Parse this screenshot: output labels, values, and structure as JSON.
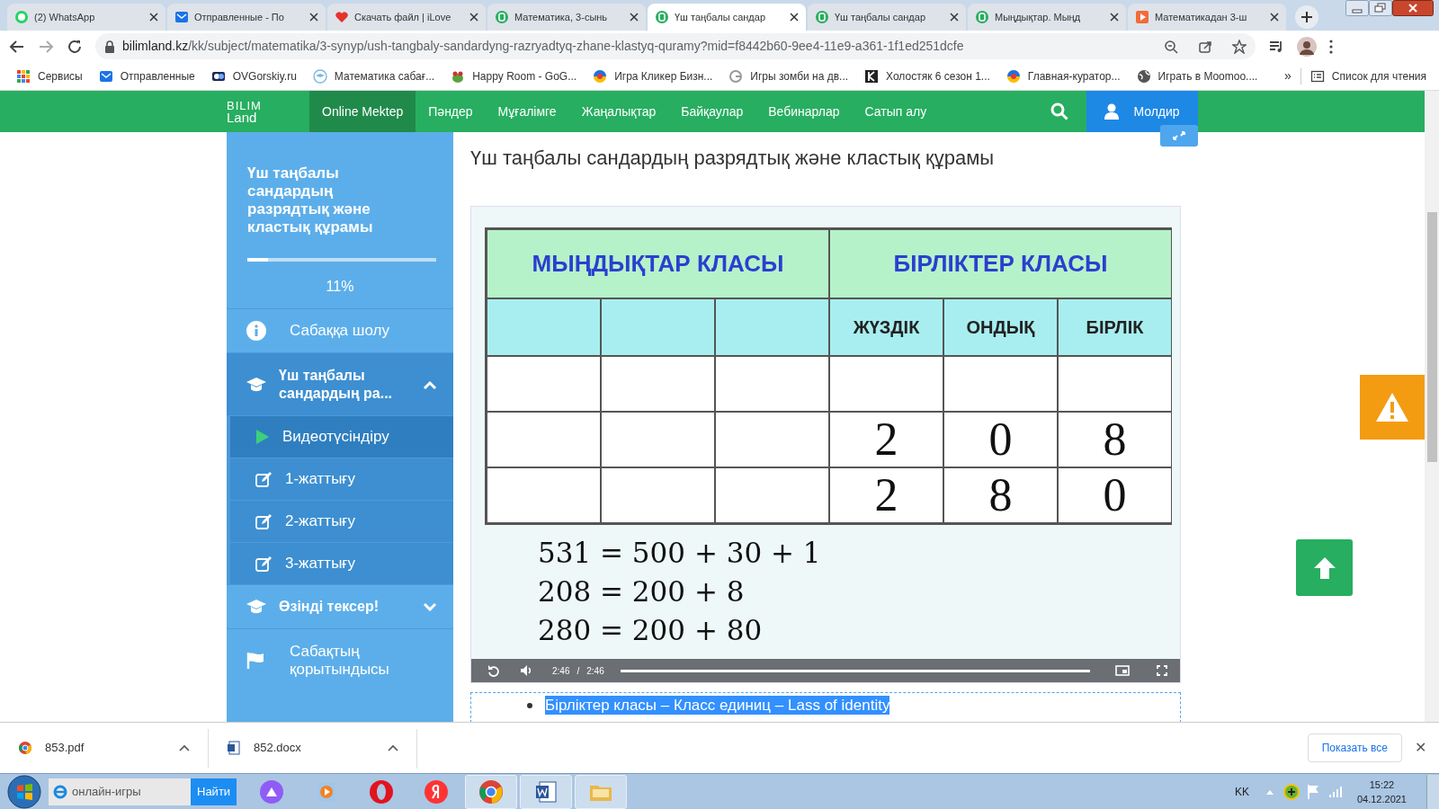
{
  "browser": {
    "tabs": [
      {
        "title": "(2) WhatsApp",
        "selected": false
      },
      {
        "title": "Отправленные - По",
        "selected": false
      },
      {
        "title": "Скачать файл | iLove",
        "selected": false
      },
      {
        "title": "Математика, 3-сынь",
        "selected": false
      },
      {
        "title": "Үш таңбалы сандар",
        "selected": true
      },
      {
        "title": "Үш таңбалы сандар",
        "selected": false
      },
      {
        "title": "Мыңдықтар. Мыңд",
        "selected": false
      },
      {
        "title": "Математикадан 3-ш",
        "selected": false
      }
    ],
    "address": {
      "domain": "bilimland.kz",
      "path": "/kk/subject/matematika/3-synyp/ush-tangbaly-sandardyng-razryadtyq-zhane-klastyq-quramy?mid=f8442b60-9ee4-11e9-a361-1f1ed251dcfe"
    },
    "bookmarks": [
      {
        "label": "Сервисы"
      },
      {
        "label": "Отправленные"
      },
      {
        "label": "OVGorskiy.ru"
      },
      {
        "label": "Математика сабағ..."
      },
      {
        "label": "Happy Room - GoG..."
      },
      {
        "label": "Игра Кликер Бизн..."
      },
      {
        "label": "Игры зомби на дв..."
      },
      {
        "label": "Холостяк 6 сезон 1..."
      },
      {
        "label": "Главная-куратор..."
      },
      {
        "label": "Играть в Moomoo...."
      }
    ],
    "overflow": "»",
    "reading_list": "Список для чтения"
  },
  "site": {
    "logo": [
      "BILIM",
      "Land"
    ],
    "nav": [
      {
        "label": "Online Mektep",
        "selected": true
      },
      {
        "label": "Пәндер",
        "selected": false
      },
      {
        "label": "Мұғалімге",
        "selected": false
      },
      {
        "label": "Жаңалықтар",
        "selected": false
      },
      {
        "label": "Байқаулар",
        "selected": false
      },
      {
        "label": "Вебинарлар",
        "selected": false
      },
      {
        "label": "Сатып алу",
        "selected": false
      }
    ],
    "user": "Молдир"
  },
  "sidebar": {
    "lesson_title": "Үш таңбалы сандардың разрядтық және кластық құрамы",
    "progress": {
      "level": 0.11,
      "label": "11%"
    },
    "items": [
      {
        "kind": "overview",
        "label": "Сабаққа шолу",
        "selected": false
      },
      {
        "kind": "section",
        "label": "Үш таңбалы сандардың ра...",
        "expanded": true,
        "selected": false,
        "children": [
          {
            "kind": "video",
            "label": "Видеотүсіндіру",
            "selected": true
          },
          {
            "kind": "exercise",
            "label": "1-жаттығу",
            "selected": false
          },
          {
            "kind": "exercise",
            "label": "2-жаттығу",
            "selected": false
          },
          {
            "kind": "exercise",
            "label": "3-жаттығу",
            "selected": false
          }
        ]
      },
      {
        "kind": "section",
        "label": "Өзінді тексер!",
        "expanded": false,
        "selected": false
      },
      {
        "kind": "summary",
        "label": "Сабақтың қорытындысы",
        "selected": false
      }
    ]
  },
  "content": {
    "title": "Үш таңбалы сандардың разрядтық және кластық құрамы",
    "video": {
      "class_headers": [
        "МЫҢДЫҚТАР КЛАСЫ",
        "БІРЛІКТЕР КЛАСЫ"
      ],
      "unit_headers": [
        "ЖҮЗДІК",
        "ОНДЫҚ",
        "БІРЛІК"
      ],
      "rows": [
        [
          "2",
          "0",
          "8"
        ],
        [
          "2",
          "8",
          "0"
        ]
      ],
      "equations": [
        "531 = 500 + 30 + 1",
        "208 = 200 + 8",
        "280 = 200 + 80"
      ],
      "player": {
        "elapsed": "2:46",
        "separator": "/",
        "duration": "2:46",
        "level": 1
      }
    },
    "notes": [
      {
        "text": "Бірліктер класы – Класс единиц – Lass of identity",
        "selected": true
      }
    ]
  },
  "downloads": {
    "files": [
      {
        "name": "853.pdf"
      },
      {
        "name": "852.docx"
      }
    ],
    "show_all": "Показать все",
    "close": "✕"
  },
  "taskbar": {
    "search": {
      "value": "онлайн-игры",
      "button": "Найти"
    },
    "apps": [
      {
        "kind": "alice",
        "open": false
      },
      {
        "kind": "media",
        "open": false
      },
      {
        "kind": "opera",
        "open": false
      },
      {
        "kind": "yandex",
        "open": false
      },
      {
        "kind": "chrome",
        "open": true
      },
      {
        "kind": "word",
        "open": true
      },
      {
        "kind": "folder",
        "open": true
      }
    ],
    "language": "KK",
    "time": "15:22",
    "date": "04.12.2021"
  }
}
